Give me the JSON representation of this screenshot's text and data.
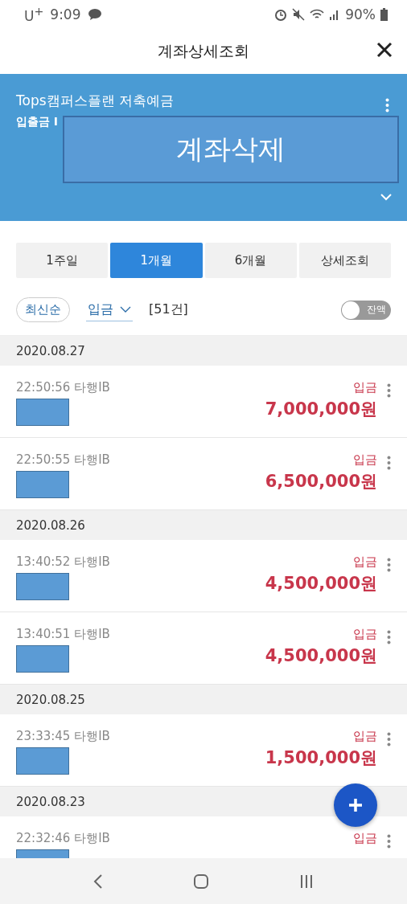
{
  "status_bar": {
    "carrier": "U",
    "carrier_mark": "+",
    "time": "9:09",
    "battery": "90%"
  },
  "header": {
    "title": "계좌상세조회"
  },
  "account": {
    "name": "Tops캠퍼스플랜 저축예금",
    "type": "입출금 I",
    "overlay_label": "계좌삭제"
  },
  "period_tabs": [
    {
      "label": "1주일",
      "selected": false
    },
    {
      "label": "1개월",
      "selected": true
    },
    {
      "label": "6개월",
      "selected": false
    },
    {
      "label": "상세조회",
      "selected": false
    }
  ],
  "filters": {
    "sort": "최신순",
    "type": "입금",
    "count": "[51건]",
    "balance_toggle": {
      "label": "잔액",
      "on": false
    }
  },
  "groups": [
    {
      "date": "2020.08.27",
      "transactions": [
        {
          "time": "22:50:56 타행IB",
          "kind": "입금",
          "amount": "7,000,000원"
        },
        {
          "time": "22:50:55 타행IB",
          "kind": "입금",
          "amount": "6,500,000원"
        }
      ]
    },
    {
      "date": "2020.08.26",
      "transactions": [
        {
          "time": "13:40:52 타행IB",
          "kind": "입금",
          "amount": "4,500,000원"
        },
        {
          "time": "13:40:51 타행IB",
          "kind": "입금",
          "amount": "4,500,000원"
        }
      ]
    },
    {
      "date": "2020.08.25",
      "transactions": [
        {
          "time": "23:33:45 타행IB",
          "kind": "입금",
          "amount": "1,500,000원"
        }
      ]
    },
    {
      "date": "2020.08.23",
      "transactions": [
        {
          "time": "22:32:46 타행IB",
          "kind": "입금"
        }
      ]
    }
  ]
}
